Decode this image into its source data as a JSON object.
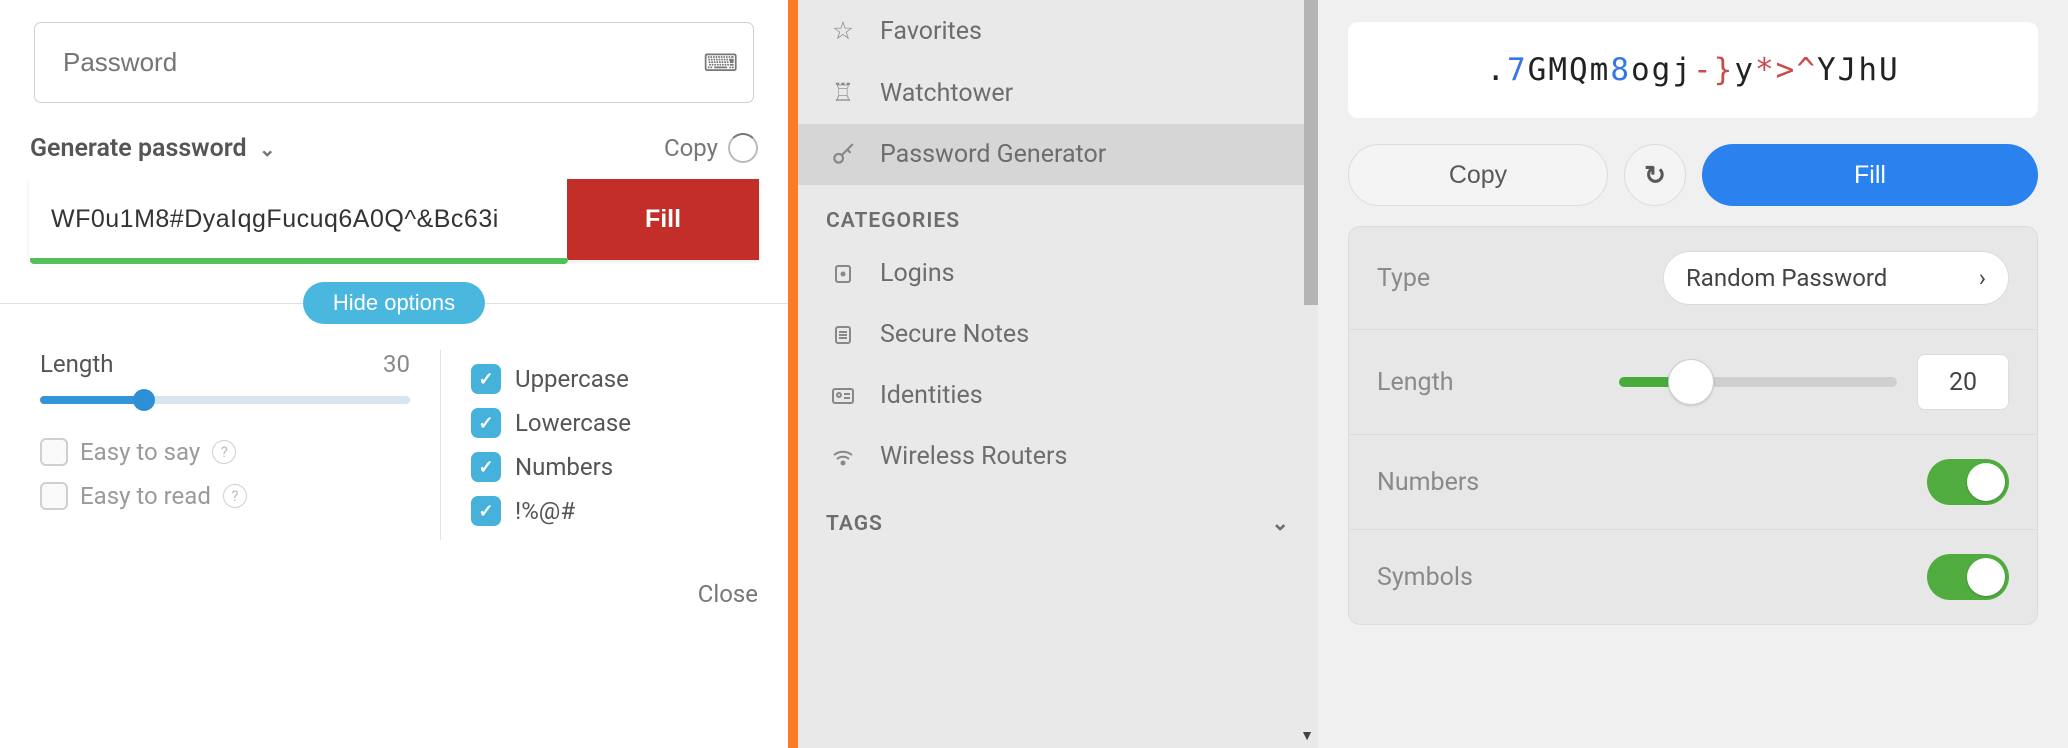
{
  "left": {
    "placeholder": "Password",
    "title": "Generate password",
    "copy": "Copy",
    "value": "WF0u1M8#DyaIqgFucuq6A0Q^&Bc63i",
    "fill": "Fill",
    "hide": "Hide options",
    "length_label": "Length",
    "length_value": "30",
    "slider_pct": 28,
    "easy_say": "Easy to say",
    "easy_read": "Easy to read",
    "upper": "Uppercase",
    "lower": "Lowercase",
    "numbers": "Numbers",
    "symbols": "!%@#",
    "close": "Close"
  },
  "mid": {
    "favorites": "Favorites",
    "watchtower": "Watchtower",
    "pwgen": "Password Generator",
    "categories": "CATEGORIES",
    "logins": "Logins",
    "notes": "Secure Notes",
    "identities": "Identities",
    "routers": "Wireless Routers",
    "tags": "TAGS"
  },
  "right": {
    "pw": {
      "full": ".7GMQm8ogj-}y*>^YJhU",
      "s0": "text:.",
      "s1": "num:7",
      "s2": "text:GMQm",
      "s3": "num:8",
      "s4": "text:ogj",
      "s5": "sym:-}",
      "s6": "text:y",
      "s7": "sym:*>^",
      "s8": "text:YJhU"
    },
    "copy": "Copy",
    "fill": "Fill",
    "type_label": "Type",
    "type_value": "Random Password",
    "length_label": "Length",
    "length_value": "20",
    "length_pct": 26,
    "numbers": "Numbers",
    "symbols": "Symbols"
  }
}
